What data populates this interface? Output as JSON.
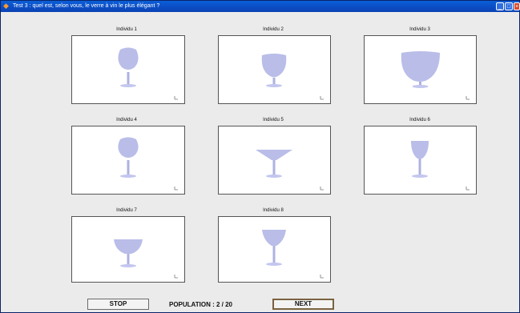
{
  "window": {
    "title": "Test 3 : quel est, selon vous, le verre à vin le plus élégant ?"
  },
  "individuals": [
    {
      "label": "Individu 1"
    },
    {
      "label": "Individu 2"
    },
    {
      "label": "Individu 3"
    },
    {
      "label": "Individu 4"
    },
    {
      "label": "Individu 5"
    },
    {
      "label": "Individu 6"
    },
    {
      "label": "Individu 7"
    },
    {
      "label": "Individu 8"
    }
  ],
  "footer": {
    "stop_label": "STOP",
    "population_label": "POPULATION : 2 / 20",
    "next_label": "NEXT"
  },
  "colors": {
    "glass": "#b9bde8",
    "title_bar": "#0a4fc4"
  }
}
